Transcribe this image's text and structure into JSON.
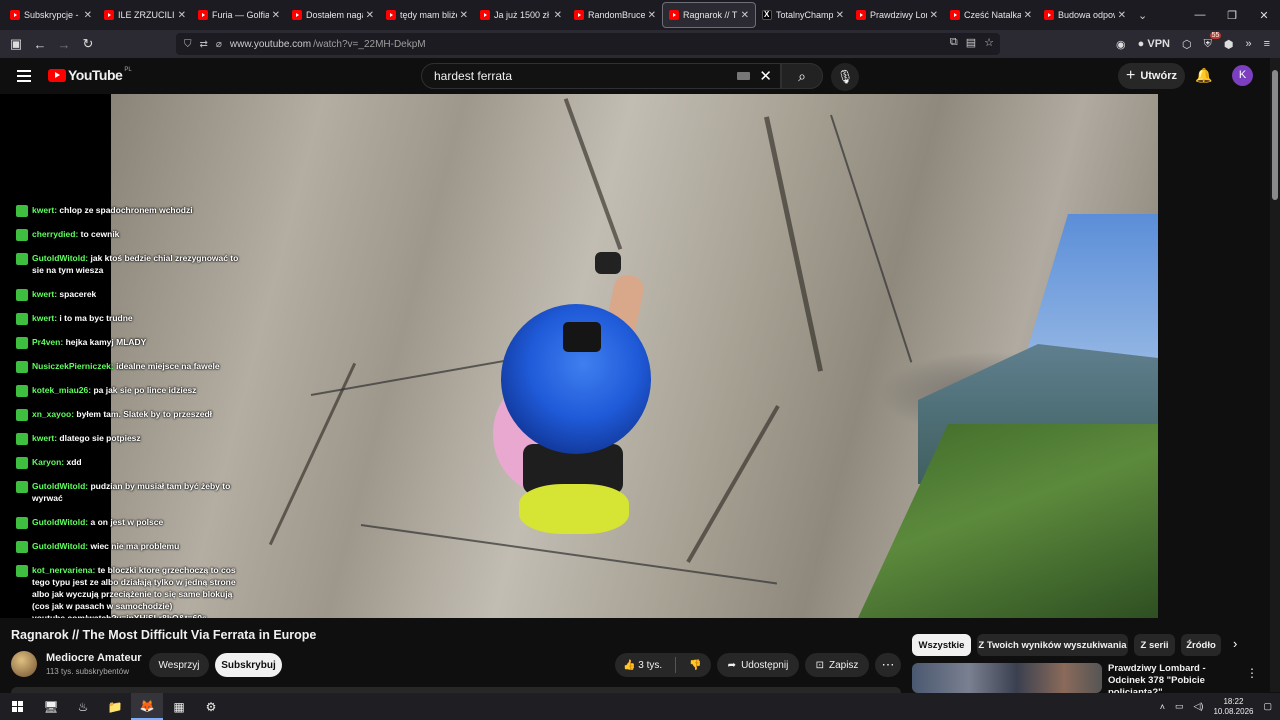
{
  "browser": {
    "tabs": [
      {
        "label": "Subskrypcje - Yo",
        "icon": "youtube-icon"
      },
      {
        "label": "ILE ZRZUCILI PO",
        "icon": "youtube-icon"
      },
      {
        "label": "Furia — Golfiarz",
        "icon": "youtube-icon"
      },
      {
        "label": "Dostałem nagan",
        "icon": "youtube-icon"
      },
      {
        "label": "tędy mam bliżej",
        "icon": "youtube-icon"
      },
      {
        "label": "Ja już 1500 zł pr",
        "icon": "youtube-icon"
      },
      {
        "label": "RandomBruce: P",
        "icon": "youtube-icon"
      },
      {
        "label": "Ragnarok // The",
        "icon": "youtube-icon",
        "active": true
      },
      {
        "label": "TotalnyChampio",
        "icon": "x-icon"
      },
      {
        "label": "Prawdziwy Lomb",
        "icon": "youtube-icon"
      },
      {
        "label": "Cześć Natalka, n",
        "icon": "youtube-icon"
      },
      {
        "label": "Budowa odpow",
        "icon": "youtube-icon"
      }
    ],
    "url_host": "www.youtube.com",
    "url_path": "/watch?v=_22MH-DekpM",
    "vpn_label": "VPN",
    "ext_badge": "55"
  },
  "youtube": {
    "logo_text": "YouTube",
    "logo_country": "PL",
    "search_value": "hardest ferrata",
    "create_label": "Utwórz",
    "avatar_letter": "K"
  },
  "chat": [
    {
      "user": "kwert:",
      "text": "chlop ze spadochronem wchodzi"
    },
    {
      "user": "cherrydied:",
      "text": "to cewnik"
    },
    {
      "user": "GutoldWitold:",
      "text": "jak ktoś bedzie chial zrezygnować to sie na tym wiesza"
    },
    {
      "user": "kwert:",
      "text": "spacerek"
    },
    {
      "user": "kwert:",
      "text": "i to ma byc trudne"
    },
    {
      "user": "Pr4ven:",
      "text": "hejka kamyj MLADY"
    },
    {
      "user": "NusiczekPierniczek:",
      "text": "idealne miejsce na fawele"
    },
    {
      "user": "kotek_miau26:",
      "text": "pa jak sie po lince idziesz"
    },
    {
      "user": "xn_xayoo:",
      "text": "byłem tam. Slatek by to przeszedł"
    },
    {
      "user": "kwert:",
      "text": "dlatego sie potpiesz"
    },
    {
      "user": "Karyon:",
      "text": "xdd"
    },
    {
      "user": "GutoldWitold:",
      "text": "pudzian by musiał tam być żeby to wyrwać"
    },
    {
      "user": "GutoldWitold:",
      "text": "a on jest w polsce"
    },
    {
      "user": "GutoldWitold:",
      "text": "wiec nie ma problemu"
    },
    {
      "user": "kot_nervariena:",
      "text": "te bloczki ktore grzechoczą to cos tego typu jest ze albo działają tylko w jedną strone albo jak wyczują przeciążenie to się same blokują (cos jak w pasach w samochodzie) youtube.com/watch?v=ipXHjSLr8bQ&t=60s"
    },
    {
      "user": "kwert:",
      "text": "owlasnie dawaj na materhorn"
    },
    {
      "user": "xn_xayoo:",
      "text": "te linki tam 100 lat wiszą, przeczytaj sobie skąd się wzięły via ferraty"
    }
  ],
  "video": {
    "title": "Ragnarok // The Most Difficult Via Ferrata in Europe",
    "channel": "Mediocre Amateur",
    "subscribers": "113 tys. subskrybentów",
    "join_label": "Wesprzyj",
    "subscribe_label": "Subskrybuj",
    "likes": "3 tys.",
    "share_label": "Udostępnij",
    "save_label": "Zapisz"
  },
  "chips": [
    "Wszystkie",
    "Z Twoich wyników wyszukiwania",
    "Z serii",
    "Źródło"
  ],
  "recommendation": {
    "title": "Prawdziwy Lombard - Odcinek 378 \"Pobicie policjanta?\""
  },
  "taskbar": {
    "time": "18:22",
    "date": "10.08.2026"
  }
}
